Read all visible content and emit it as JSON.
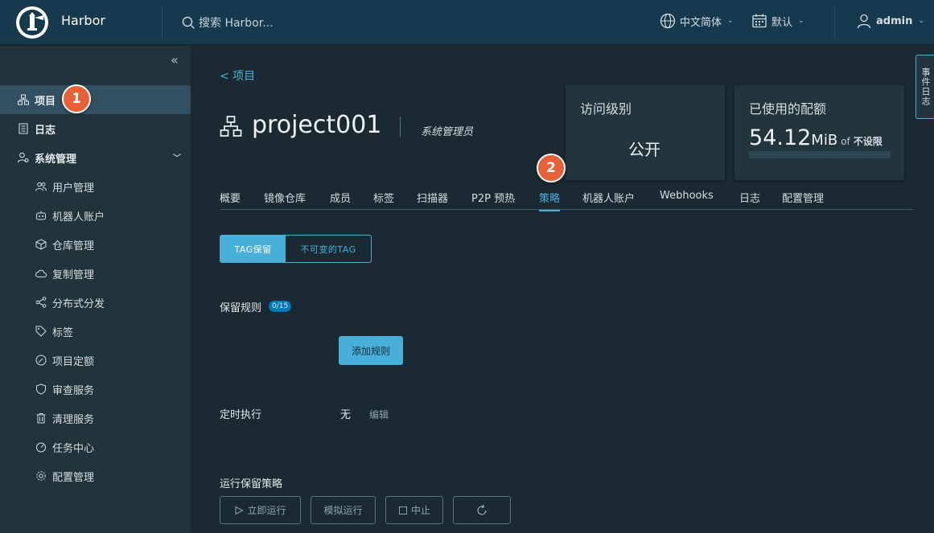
{
  "header": {
    "brand": "Harbor",
    "search_placeholder": "搜索 Harbor...",
    "language": "中文简体",
    "calendar": "默认",
    "user": "admin"
  },
  "sidebar": {
    "items": [
      {
        "label": "项目",
        "icon": "projects-icon",
        "active": true
      },
      {
        "label": "日志",
        "icon": "logs-icon"
      },
      {
        "label": "系统管理",
        "icon": "admin-icon",
        "expanded": true
      }
    ],
    "admin_items": [
      {
        "label": "用户管理",
        "icon": "users-icon"
      },
      {
        "label": "机器人账户",
        "icon": "robot-icon"
      },
      {
        "label": "仓库管理",
        "icon": "registry-icon"
      },
      {
        "label": "复制管理",
        "icon": "replication-icon"
      },
      {
        "label": "分布式分发",
        "icon": "distribution-icon"
      },
      {
        "label": "标签",
        "icon": "tag-icon"
      },
      {
        "label": "项目定额",
        "icon": "quota-icon"
      },
      {
        "label": "审查服务",
        "icon": "shield-icon"
      },
      {
        "label": "清理服务",
        "icon": "trash-icon"
      },
      {
        "label": "任务中心",
        "icon": "dashboard-icon"
      },
      {
        "label": "配置管理",
        "icon": "gear-icon"
      }
    ]
  },
  "markers": {
    "one": "1",
    "two": "2"
  },
  "project": {
    "back_label": "<  项目",
    "name": "project001",
    "role": "系统管理员"
  },
  "cards": {
    "access_label": "访问级别",
    "access_value": "公开",
    "quota_label": "已使用的配额",
    "quota_value": "54.12",
    "quota_unit": "MiB",
    "quota_of": "of",
    "quota_limit": "不设限"
  },
  "tabs": [
    "概要",
    "镜像仓库",
    "成员",
    "标签",
    "扫描器",
    "P2P 预热",
    "策略",
    "机器人账户",
    "Webhooks",
    "日志",
    "配置管理"
  ],
  "policy": {
    "seg_on": "TAG保留",
    "seg_off": "不可变的TAG",
    "retention_label": "保留规则",
    "retention_count": "0/15",
    "add_rule": "添加规则",
    "schedule_label": "定时执行",
    "schedule_value": "无",
    "edit": "编辑",
    "run_label": "运行保留策略",
    "run_now": "立即运行",
    "dry_run": "模拟运行",
    "stop": "中止"
  },
  "side_panel": {
    "label": "事件日志"
  },
  "colors": {
    "accent": "#49afd9",
    "header": "#17394d",
    "sidebar": "#21333b",
    "marker": "#e86038"
  }
}
